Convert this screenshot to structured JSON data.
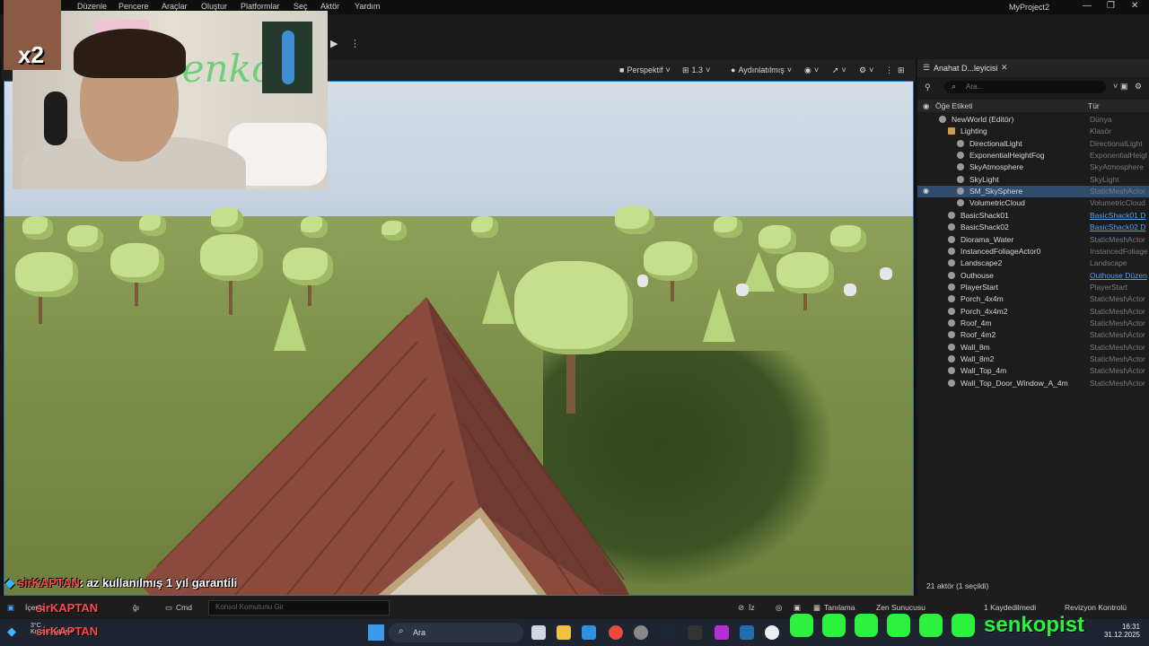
{
  "menu": [
    "Düzenle",
    "Pencere",
    "Araçlar",
    "Oluştur",
    "Platformlar",
    "Seç",
    "Aktör",
    "Yardım"
  ],
  "project_title": "MyProject2",
  "viewport_toolbar": {
    "perspective": "Perspektif",
    "fov": "1.3",
    "lighting": "Aydınlatılmış"
  },
  "webcam": {
    "sign_text": "Senko",
    "badge": "x2"
  },
  "outliner": {
    "tab_label": "Anahat D...leyicisi",
    "search_placeholder": "Ara...",
    "col_label": "Öğe Etiketi",
    "col_type": "Tür",
    "rows": [
      {
        "name": "NewWorld (Editör)",
        "type": "Dünya",
        "indent": 1,
        "icon": "world"
      },
      {
        "name": "Lighting",
        "type": "Klasör",
        "indent": 2,
        "icon": "folder"
      },
      {
        "name": "DirectionalLight",
        "type": "DirectionalLight",
        "indent": 3,
        "icon": "light"
      },
      {
        "name": "ExponentialHeightFog",
        "type": "ExponentialHeigh",
        "indent": 3,
        "icon": "fog"
      },
      {
        "name": "SkyAtmosphere",
        "type": "SkyAtmosphere",
        "indent": 3,
        "icon": "sky"
      },
      {
        "name": "SkyLight",
        "type": "SkyLight",
        "indent": 3,
        "icon": "skylight"
      },
      {
        "name": "SM_SkySphere",
        "type": "StaticMeshActor",
        "indent": 3,
        "icon": "mesh",
        "selected": true
      },
      {
        "name": "VolumetricCloud",
        "type": "VolumetricCloud",
        "indent": 3,
        "icon": "cloud"
      },
      {
        "name": "BasicShack01",
        "type": "BasicShack01 D",
        "indent": 2,
        "icon": "actor",
        "link": true
      },
      {
        "name": "BasicShack02",
        "type": "BasicShack02 D",
        "indent": 2,
        "icon": "actor",
        "link": true
      },
      {
        "name": "Diorama_Water",
        "type": "StaticMeshActor",
        "indent": 2,
        "icon": "mesh"
      },
      {
        "name": "InstancedFoliageActor0",
        "type": "InstancedFoliage",
        "indent": 2,
        "icon": "actor"
      },
      {
        "name": "Landscape2",
        "type": "Landscape",
        "indent": 2,
        "icon": "landscape"
      },
      {
        "name": "Outhouse",
        "type": "Outhouse Düzen",
        "indent": 2,
        "icon": "actor",
        "link": true
      },
      {
        "name": "PlayerStart",
        "type": "PlayerStart",
        "indent": 2,
        "icon": "actor"
      },
      {
        "name": "Porch_4x4m",
        "type": "StaticMeshActor",
        "indent": 2,
        "icon": "mesh"
      },
      {
        "name": "Porch_4x4m2",
        "type": "StaticMeshActor",
        "indent": 2,
        "icon": "mesh"
      },
      {
        "name": "Roof_4m",
        "type": "StaticMeshActor",
        "indent": 2,
        "icon": "mesh"
      },
      {
        "name": "Roof_4m2",
        "type": "StaticMeshActor",
        "indent": 2,
        "icon": "mesh"
      },
      {
        "name": "Wall_8m",
        "type": "StaticMeshActor",
        "indent": 2,
        "icon": "mesh"
      },
      {
        "name": "Wall_8m2",
        "type": "StaticMeshActor",
        "indent": 2,
        "icon": "mesh"
      },
      {
        "name": "Wall_Top_4m",
        "type": "StaticMeshActor",
        "indent": 2,
        "icon": "mesh"
      },
      {
        "name": "Wall_Top_Door_Window_A_4m",
        "type": "StaticMeshActor",
        "indent": 2,
        "icon": "mesh"
      }
    ],
    "actor_count": "21 aktör (1 seçildi)"
  },
  "status_bar": {
    "cmd_label": "Cmd",
    "cmd_placeholder": "Konsol Komutunu Gir",
    "iz": "İz",
    "diagnostics": "Tanılama",
    "zen_server": "Zen Sunucusu",
    "saved": "1 Kaydedilmedi",
    "revision": "Revizyon Kontrolü",
    "content_partial_a": "İçerik",
    "content_partial_b": "ğı",
    "chat_user_overlay": "sirKAPTAN"
  },
  "chat": {
    "user": "sirKAPTAN",
    "message": ": az kullanılmış 1 yıl garantili"
  },
  "taskbar": {
    "search": "Ara",
    "weather_temp": "3°C",
    "weather_desc": "Kısmen güneşli",
    "time": "16:31",
    "date": "31.12.2025"
  },
  "social_handle": "senkopist"
}
